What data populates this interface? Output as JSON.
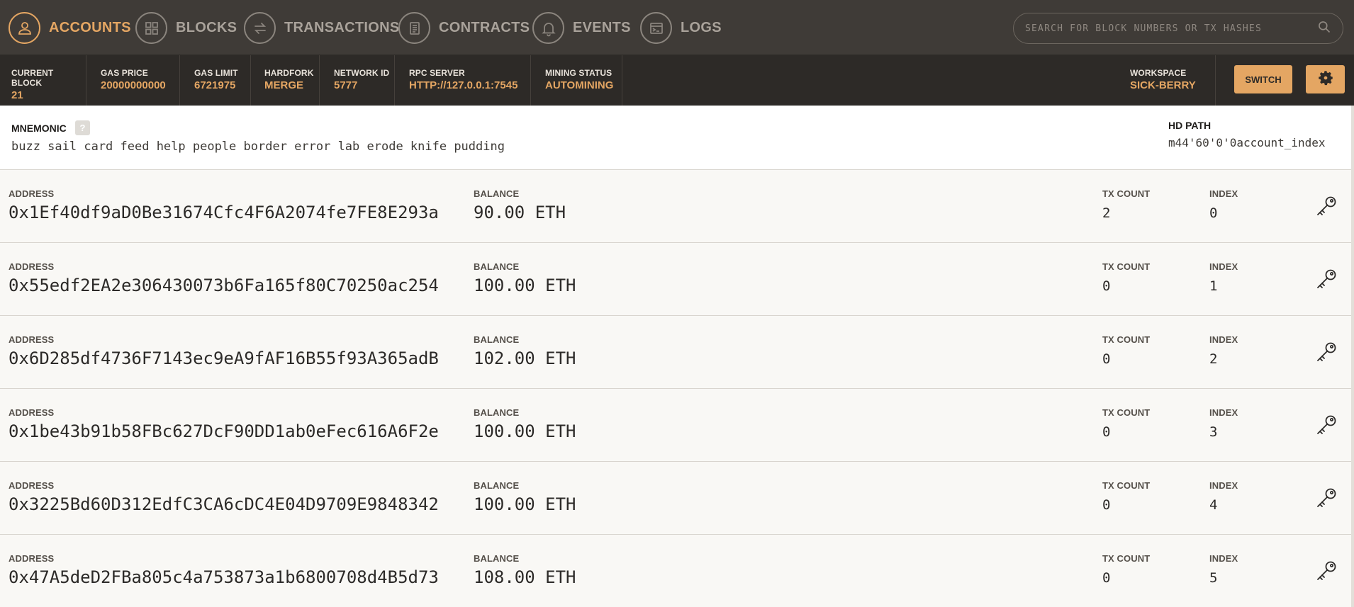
{
  "nav": {
    "items": [
      {
        "label": "ACCOUNTS",
        "icon": "person-icon"
      },
      {
        "label": "BLOCKS",
        "icon": "blocks-grid-icon"
      },
      {
        "label": "TRANSACTIONS",
        "icon": "swap-arrows-icon"
      },
      {
        "label": "CONTRACTS",
        "icon": "document-icon"
      },
      {
        "label": "EVENTS",
        "icon": "bell-icon"
      },
      {
        "label": "LOGS",
        "icon": "terminal-icon"
      }
    ],
    "search_placeholder": "SEARCH FOR BLOCK NUMBERS OR TX HASHES"
  },
  "status": {
    "current_block": {
      "label": "CURRENT BLOCK",
      "value": "21"
    },
    "gas_price": {
      "label": "GAS PRICE",
      "value": "20000000000"
    },
    "gas_limit": {
      "label": "GAS LIMIT",
      "value": "6721975"
    },
    "hardfork": {
      "label": "HARDFORK",
      "value": "MERGE"
    },
    "network_id": {
      "label": "NETWORK ID",
      "value": "5777"
    },
    "rpc_server": {
      "label": "RPC SERVER",
      "value": "HTTP://127.0.0.1:7545"
    },
    "mining_status": {
      "label": "MINING STATUS",
      "value": "AUTOMINING"
    },
    "workspace": {
      "label": "WORKSPACE",
      "value": "SICK-BERRY"
    },
    "switch_label": "SWITCH"
  },
  "mnemonic": {
    "title": "MNEMONIC",
    "help": "?",
    "words": "buzz sail card feed help people border error lab erode knife pudding",
    "hd_path_title": "HD PATH",
    "hd_path_value": "m44'60'0'0account_index"
  },
  "labels": {
    "address": "ADDRESS",
    "balance": "BALANCE",
    "tx_count": "TX COUNT",
    "index": "INDEX"
  },
  "accounts": [
    {
      "address": "0x1Ef40df9aD0Be31674Cfc4F6A2074fe7FE8E293a",
      "balance": "90.00 ETH",
      "tx_count": "2",
      "index": "0"
    },
    {
      "address": "0x55edf2EA2e306430073b6Fa165f80C70250ac254",
      "balance": "100.00 ETH",
      "tx_count": "0",
      "index": "1"
    },
    {
      "address": "0x6D285df4736F7143ec9eA9fAF16B55f93A365adB",
      "balance": "102.00 ETH",
      "tx_count": "0",
      "index": "2"
    },
    {
      "address": "0x1be43b91b58FBc627DcF90DD1ab0eFec616A6F2e",
      "balance": "100.00 ETH",
      "tx_count": "0",
      "index": "3"
    },
    {
      "address": "0x3225Bd60D312EdfC3CA6cDC4E04D9709E9848342",
      "balance": "100.00 ETH",
      "tx_count": "0",
      "index": "4"
    },
    {
      "address": "0x47A5deD2FBa805c4a753873a1b6800708d4B5d73",
      "balance": "108.00 ETH",
      "tx_count": "0",
      "index": "5"
    }
  ],
  "colors": {
    "accent": "#e4a663",
    "nav_bg": "#3f3b37",
    "status_bg": "#2d2a27"
  }
}
